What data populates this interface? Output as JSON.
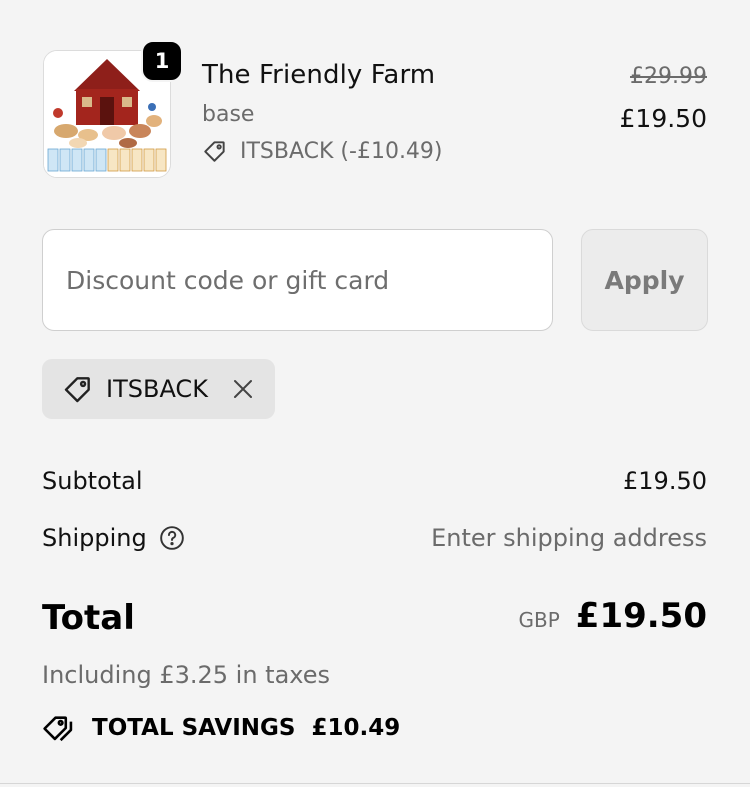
{
  "line_item": {
    "quantity": "1",
    "title": "The Friendly Farm",
    "variant": "base",
    "discount_text": "ITSBACK (-£10.49)",
    "original_price": "£29.99",
    "price": "£19.50"
  },
  "discount": {
    "placeholder": "Discount code or gift card",
    "apply_label": "Apply",
    "applied_code": "ITSBACK"
  },
  "summary": {
    "subtotal_label": "Subtotal",
    "subtotal_value": "£19.50",
    "shipping_label": "Shipping",
    "shipping_value": "Enter shipping address",
    "total_label": "Total",
    "currency": "GBP",
    "total_value": "£19.50",
    "tax_note": "Including £3.25 in taxes",
    "savings_label": "TOTAL SAVINGS",
    "savings_value": "£10.49"
  },
  "icons": {
    "discount_tag": "tag-icon",
    "remove": "close-icon",
    "help": "question-circle-icon",
    "savings": "double-tag-icon"
  }
}
